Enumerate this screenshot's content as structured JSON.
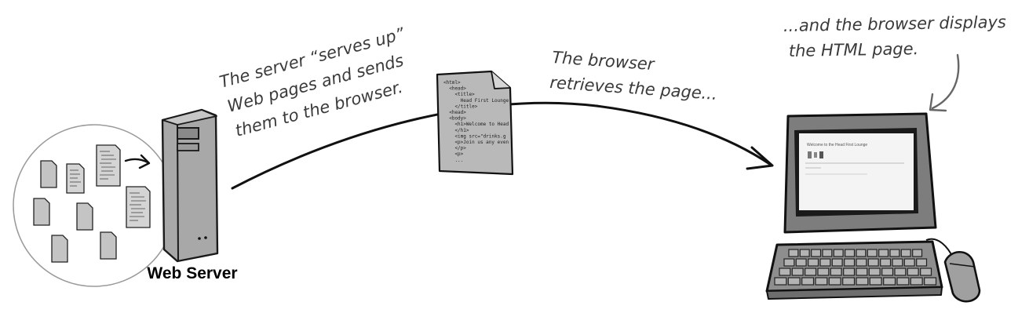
{
  "annotations": {
    "server_note": [
      "The server “serves up”",
      "Web pages and sends",
      "them to the browser."
    ],
    "browser_note": [
      "The browser",
      "retrieves the page..."
    ],
    "display_note": [
      "...and the browser displays",
      "the HTML page."
    ]
  },
  "server_label": "Web Server",
  "document_code": [
    "<html>",
    "  <head>",
    "    <title>",
    "      Head First Lounge",
    "    </title>",
    "  <head>",
    "  <body>",
    "    <h1>Welcome to Head",
    "    </h1>",
    "    <img src=\"drinks.g",
    "    <p>Join us any even",
    "    </p>",
    "    <p>",
    "    ..."
  ],
  "screen_page": {
    "heading": "Welcome to the Head First Lounge"
  },
  "colors": {
    "ink": "#222222",
    "server_gray": "#9a9a9a",
    "doc_gray": "#b5b5b5",
    "monitor_gray": "#7d7d7d"
  }
}
